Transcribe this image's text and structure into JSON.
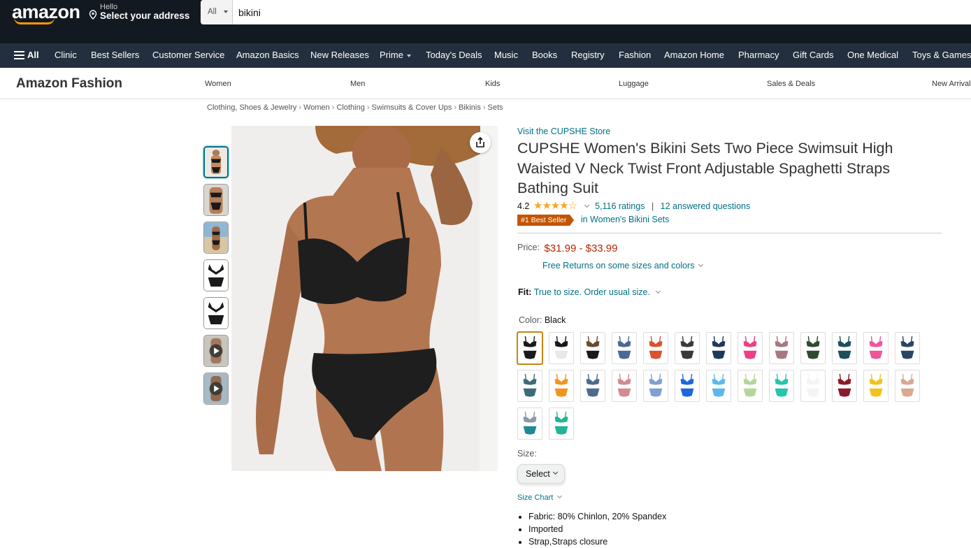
{
  "header": {
    "logo": "amazon",
    "address_hello": "Hello",
    "address_select": "Select your address",
    "search_category": "All",
    "search_query": "bikini"
  },
  "nav": {
    "all": "All",
    "items": [
      "Clinic",
      "Best Sellers",
      "Customer Service",
      "Amazon Basics",
      "New Releases",
      "Prime",
      "Today's Deals",
      "Music",
      "Books",
      "Registry",
      "Fashion",
      "Amazon Home",
      "Pharmacy",
      "Gift Cards",
      "One Medical",
      "Toys & Games"
    ]
  },
  "fashion_bar": {
    "title": "Amazon Fashion",
    "items": [
      "Women",
      "Men",
      "Kids",
      "Luggage",
      "Sales & Deals",
      "New Arrivals"
    ]
  },
  "breadcrumb": [
    "Clothing, Shoes & Jewelry",
    "Women",
    "Clothing",
    "Swimsuits & Cover Ups",
    "Bikinis",
    "Sets"
  ],
  "product": {
    "store_link": "Visit the CUPSHE Store",
    "title": "CUPSHE Women's Bikini Sets Two Piece Swimsuit High Waisted V Neck Twist Front Adjustable Spaghetti Straps Bathing Suit",
    "rating": "4.2",
    "rating_stars": 4.2,
    "ratings_count": "5,116 ratings",
    "rating_sep": "|",
    "answered": "12 answered questions",
    "badge": "#1 Best Seller",
    "badge_category": "in Women's Bikini Sets",
    "price_label": "Price:",
    "price": "$31.99 - $33.99",
    "returns": "Free Returns on some sizes and colors",
    "fit_label": "Fit:",
    "fit_value": "True to size. Order usual size.",
    "color_label": "Color:",
    "color_value": "Black",
    "size_label": "Size:",
    "size_select": "Select",
    "size_chart": "Size Chart",
    "bullets": [
      "Fabric: 80% Chinlon, 20% Spandex",
      "Imported",
      "Strap,Straps closure"
    ]
  },
  "swatch_colors": [
    {
      "top": "#1a1a1a",
      "bottom": "#1a1a1a"
    },
    {
      "top": "#1a1a1a",
      "bottom": "#e8e8e8"
    },
    {
      "top": "#6b4a2e",
      "bottom": "#1a1a1a"
    },
    {
      "top": "#4a6a96",
      "bottom": "#4a6a96"
    },
    {
      "top": "#d9532f",
      "bottom": "#d9532f"
    },
    {
      "top": "#3a3a3a",
      "bottom": "#3a3a3a"
    },
    {
      "top": "#1e3a5a",
      "bottom": "#1e3a5a"
    },
    {
      "top": "#ee3f84",
      "bottom": "#ee3f84"
    },
    {
      "top": "#a87882",
      "bottom": "#a87882"
    },
    {
      "top": "#2f4a2f",
      "bottom": "#2f4a2f"
    },
    {
      "top": "#1d4e5c",
      "bottom": "#1d4e5c"
    },
    {
      "top": "#f0559a",
      "bottom": "#f0559a"
    },
    {
      "top": "#2a4466",
      "bottom": "#2a4466"
    },
    {
      "top": "#3e6a7a",
      "bottom": "#3e6a7a"
    },
    {
      "top": "#f5931e",
      "bottom": "#f5931e"
    },
    {
      "top": "#4d6b8c",
      "bottom": "#4d6b8c"
    },
    {
      "top": "#d48a92",
      "bottom": "#d48a92"
    },
    {
      "top": "#7ea0d4",
      "bottom": "#7ea0d4"
    },
    {
      "top": "#1e66e0",
      "bottom": "#1e66e0"
    },
    {
      "top": "#5cb8ec",
      "bottom": "#5cb8ec"
    },
    {
      "top": "#b4d69a",
      "bottom": "#b4d69a"
    },
    {
      "top": "#27c4b0",
      "bottom": "#27c4b0"
    },
    {
      "top": "#f4f4f4",
      "bottom": "#f4f4f4"
    },
    {
      "top": "#8c1a2c",
      "bottom": "#8c1a2c"
    },
    {
      "top": "#f4c21c",
      "bottom": "#f4c21c"
    },
    {
      "top": "#d9a890",
      "bottom": "#d9a890"
    },
    {
      "top": "#8a9aa6",
      "bottom": "#1e8a96"
    },
    {
      "top": "#1fb596",
      "bottom": "#1fb596"
    }
  ],
  "colors": {
    "top_bar": "#131921",
    "nav_bar": "#232f3e",
    "link": "#007185",
    "price": "#b12704",
    "badge": "#c45500",
    "star": "#ffa41c"
  }
}
